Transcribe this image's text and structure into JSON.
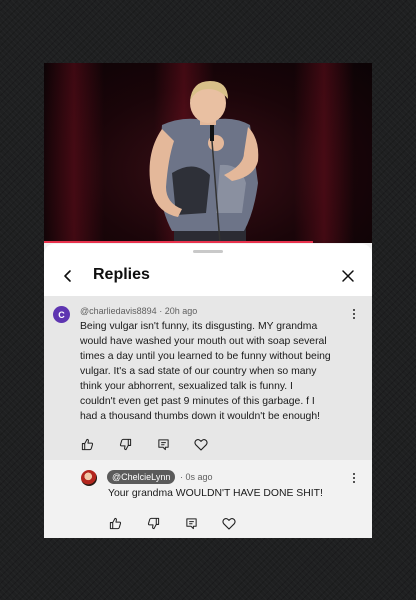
{
  "video": {
    "progress_fraction": 0.82
  },
  "panel": {
    "title": "Replies"
  },
  "comment": {
    "avatar_letter": "C",
    "author": "@charliedavis8894",
    "separator": "·",
    "time": "20h ago",
    "lines": [
      "Being vulgar isn't funny, its disgusting.  MY grandma",
      "would have washed your mouth out with soap several",
      "times a day until you learned to be funny without being",
      "vulgar.  It's a sad state of our country when so many",
      "think your abhorrent, sexualized talk is funny.  I",
      "couldn't even get past 9 minutes of this garbage.  f I",
      "had a thousand thumbs down it wouldn't be enough!"
    ]
  },
  "reply": {
    "author": "@ChelcieLynn",
    "separator": "·",
    "time": "0s ago",
    "text": "Your grandma WOULDN'T HAVE DONE SHIT!"
  },
  "icons": {
    "back": "chevron-left-icon",
    "close": "close-icon",
    "like": "thumbs-up-icon",
    "dislike": "thumbs-down-icon",
    "reply": "reply-icon",
    "heart": "heart-icon",
    "more": "more-vertical-icon"
  },
  "colors": {
    "progress": "#e8324d",
    "avatar_c": "#5e35b1",
    "highlight_bg": "#e7e7e7",
    "handle_pill": "#5b5b5b"
  }
}
